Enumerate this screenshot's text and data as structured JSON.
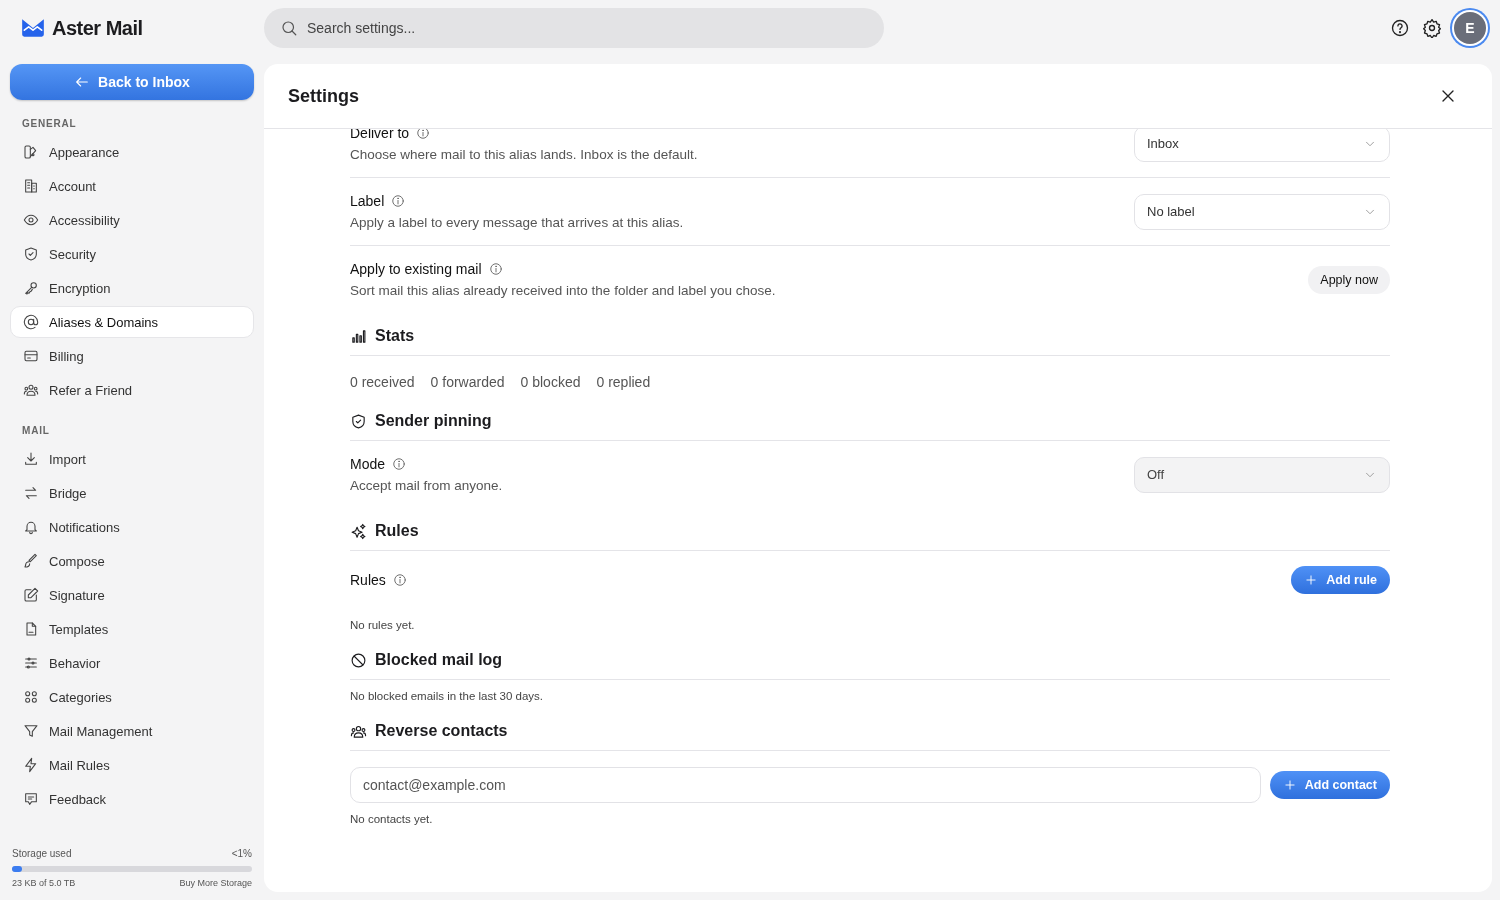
{
  "brand": {
    "name": "Aster Mail"
  },
  "back_button": {
    "label": "Back to Inbox"
  },
  "sidebar": {
    "sections": [
      {
        "title": "GENERAL",
        "items": [
          {
            "label": "Appearance",
            "selected": false
          },
          {
            "label": "Account",
            "selected": false
          },
          {
            "label": "Accessibility",
            "selected": false
          },
          {
            "label": "Security",
            "selected": false
          },
          {
            "label": "Encryption",
            "selected": false
          },
          {
            "label": "Aliases & Domains",
            "selected": true
          },
          {
            "label": "Billing",
            "selected": false
          },
          {
            "label": "Refer a Friend",
            "selected": false
          }
        ]
      },
      {
        "title": "MAIL",
        "items": [
          {
            "label": "Import",
            "selected": false
          },
          {
            "label": "Bridge",
            "selected": false
          },
          {
            "label": "Notifications",
            "selected": false
          },
          {
            "label": "Compose",
            "selected": false
          },
          {
            "label": "Signature",
            "selected": false
          },
          {
            "label": "Templates",
            "selected": false
          },
          {
            "label": "Behavior",
            "selected": false
          },
          {
            "label": "Categories",
            "selected": false
          },
          {
            "label": "Mail Management",
            "selected": false
          },
          {
            "label": "Mail Rules",
            "selected": false
          },
          {
            "label": "Feedback",
            "selected": false
          }
        ]
      }
    ],
    "storage": {
      "label": "Storage used",
      "percent": "<1%",
      "level": 0.04,
      "usage": "23 KB of 5.0 TB",
      "link": "Buy More Storage"
    }
  },
  "search": {
    "placeholder": "Search settings..."
  },
  "avatar": {
    "initial": "E"
  },
  "panel": {
    "title": "Settings",
    "blocks": [
      {
        "kind": "setting",
        "label": "Deliver to",
        "description": "Choose where mail to this alias lands. Inbox is the default.",
        "control": {
          "kind": "select",
          "value": "Inbox",
          "disabled": false
        }
      },
      {
        "kind": "setting",
        "label": "Label",
        "description": "Apply a label to every message that arrives at this alias.",
        "control": {
          "kind": "select",
          "value": "No label",
          "disabled": false
        }
      },
      {
        "kind": "setting",
        "label": "Apply to existing mail",
        "description": "Sort mail this alias already received into the folder and label you chose.",
        "control": {
          "kind": "button",
          "label": "Apply now"
        }
      },
      {
        "kind": "heading",
        "title": "Stats"
      },
      {
        "kind": "stats",
        "items": [
          "0 received",
          "0 forwarded",
          "0 blocked",
          "0 replied"
        ]
      },
      {
        "kind": "heading",
        "title": "Sender pinning"
      },
      {
        "kind": "setting",
        "label": "Mode",
        "description": "Accept mail from anyone.",
        "control": {
          "kind": "select",
          "value": "Off",
          "disabled": true
        }
      },
      {
        "kind": "heading",
        "title": "Rules"
      },
      {
        "kind": "setting",
        "label": "Rules",
        "control": {
          "kind": "primary",
          "label": "Add rule"
        }
      },
      {
        "kind": "note",
        "text": "No rules yet."
      },
      {
        "kind": "heading",
        "title": "Blocked mail log"
      },
      {
        "kind": "note",
        "text": "No blocked emails in the last 30 days."
      },
      {
        "kind": "heading",
        "title": "Reverse contacts"
      },
      {
        "kind": "contact_input",
        "placeholder": "contact@example.com",
        "button": "Add contact"
      },
      {
        "kind": "note",
        "text": "No contacts yet."
      }
    ]
  }
}
